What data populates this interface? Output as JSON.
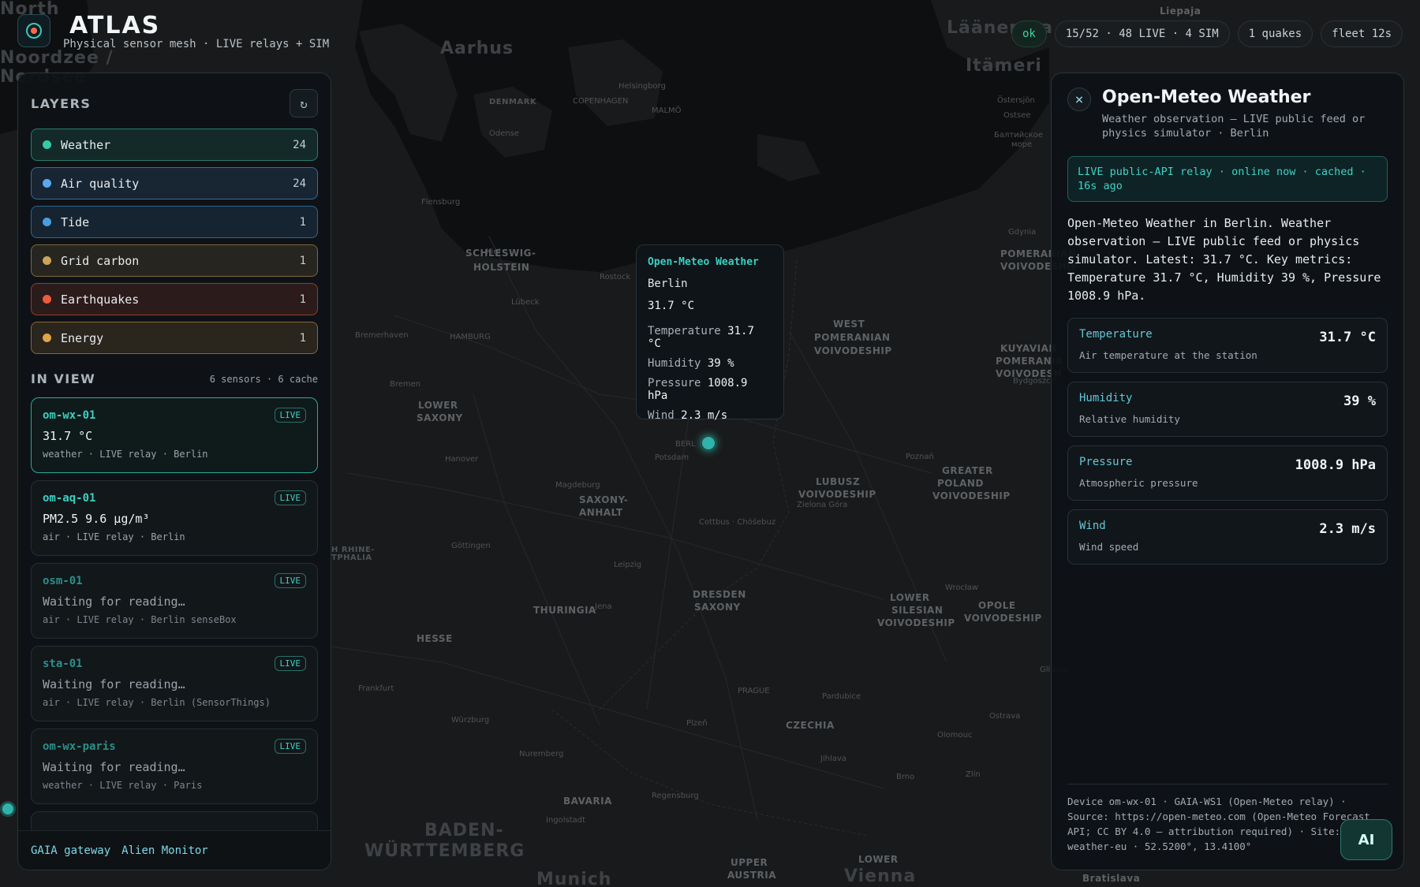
{
  "app": {
    "title": "ATLAS",
    "subtitle": "Physical sensor mesh · LIVE relays + SIM"
  },
  "status": {
    "ok": "ok",
    "counts": "15/52 · 48 LIVE · 4 SIM",
    "quakes": "1 quakes",
    "fleet": "fleet 12s"
  },
  "layers_panel": {
    "title": "LAYERS",
    "refresh_icon": "↻",
    "layers": [
      {
        "name": "Weather",
        "count": "24",
        "color": "#36c9a8"
      },
      {
        "name": "Air quality",
        "count": "24",
        "color": "#5aa8f0"
      },
      {
        "name": "Tide",
        "count": "1",
        "color": "#4a9ee0"
      },
      {
        "name": "Grid carbon",
        "count": "1",
        "color": "#c9a45a"
      },
      {
        "name": "Earthquakes",
        "count": "1",
        "color": "#ee5a3e"
      },
      {
        "name": "Energy",
        "count": "1",
        "color": "#e0a34a"
      }
    ]
  },
  "in_view": {
    "title": "IN VIEW",
    "meta": "6 sensors · 6 cache",
    "cards": [
      {
        "id": "om-wx-01",
        "badge": "LIVE",
        "value": "31.7 °C",
        "meta": "weather · LIVE relay · Berlin"
      },
      {
        "id": "om-aq-01",
        "badge": "LIVE",
        "value": "PM2.5 9.6 µg/m³",
        "meta": "air · LIVE relay · Berlin"
      },
      {
        "id": "osm-01",
        "badge": "LIVE",
        "value": "Waiting for reading…",
        "meta": "air · LIVE relay · Berlin senseBox"
      },
      {
        "id": "sta-01",
        "badge": "LIVE",
        "value": "Waiting for reading…",
        "meta": "air · LIVE relay · Berlin (SensorThings)"
      },
      {
        "id": "om-wx-paris",
        "badge": "LIVE",
        "value": "Waiting for reading…",
        "meta": "weather · LIVE relay · Paris"
      }
    ]
  },
  "left_footer": {
    "gateway": "GAIA gateway",
    "monitor": "Alien Monitor"
  },
  "popup": {
    "title": "Open-Meteo Weather",
    "city": "Berlin",
    "value": "31.7 °C",
    "rows": [
      {
        "label": "Temperature",
        "value": "31.7 °C"
      },
      {
        "label": "Humidity",
        "value": "39 %"
      },
      {
        "label": "Pressure",
        "value": "1008.9 hPa"
      },
      {
        "label": "Wind",
        "value": "2.3 m/s"
      }
    ]
  },
  "detail": {
    "close_icon": "×",
    "title": "Open-Meteo Weather",
    "subtitle": "Weather observation — LIVE public feed or physics simulator · Berlin",
    "live_status": "LIVE public-API relay · online now · cached · 16s ago",
    "description": "Open-Meteo Weather in Berlin. Weather observation — LIVE public feed or physics simulator. Latest: 31.7 °C. Key metrics: Temperature 31.7 °C, Humidity 39 %, Pressure 1008.9 hPa.",
    "metrics": [
      {
        "name": "Temperature",
        "desc": "Air temperature at the station",
        "value": "31.7 °C"
      },
      {
        "name": "Humidity",
        "desc": "Relative humidity",
        "value": "39 %"
      },
      {
        "name": "Pressure",
        "desc": "Atmospheric pressure",
        "value": "1008.9 hPa"
      },
      {
        "name": "Wind",
        "desc": "Wind speed",
        "value": "2.3 m/s"
      }
    ],
    "footer": "Device om-wx-01 · GAIA-WS1 (Open-Meteo relay) · Source: https://open-meteo.com (Open-Meteo Forecast API; CC BY 4.0 — attribution required) · Site: live-weather-eu · 52.5200°, 13.4100°",
    "ai_label": "AI"
  },
  "map_labels": {
    "regions": [
      "DENMARK",
      "SCHLESWIG-HOLSTEIN",
      "WEST POMERANIAN VOIVODESHIP",
      "POMERANIAN VOIVODESHIP",
      "KUYAVIAN POMERANIAN VOIVODESHIP",
      "LOWER SAXONY",
      "SAXONY-ANHALT",
      "LUBUSZ VOIVODESHIP",
      "GREATER POLAND VOIVODESHIP",
      "THURINGIA",
      "DRESDEN SAXONY",
      "LOWER SILESIAN VOIVODESHIP",
      "OPOLE VOIVODESHIP",
      "HESSE",
      "CZECHIA",
      "BAVARIA",
      "BADEN-WÜRTTEMBERG",
      "UPPER AUSTRIA",
      "LOWER AUSTRIA",
      "NORTH RHINE-WESTPHALIA"
    ],
    "cities": [
      "COPENHAGEN",
      "MALMÖ",
      "Aarhus",
      "Odense",
      "Helsingborg",
      "Flensburg",
      "Kiel",
      "Lübeck",
      "Rostock",
      "HAMBURG",
      "Bremerhaven",
      "Bremen",
      "Hanover",
      "Magdeburg",
      "BERLIN",
      "Potsdam",
      "Cottbus · Chóśebuz",
      "Zielona Góra",
      "Poznań",
      "Bydgoszcz",
      "Gdynia",
      "Göttingen",
      "Leipzig",
      "Jena",
      "Wrocław",
      "PRAGUE",
      "Pardubice",
      "Plzeň",
      "Brno",
      "Jihlava",
      "Zlín",
      "Olomouc",
      "Ostrava",
      "Gliwice",
      "Nuremberg",
      "Würzburg",
      "Regensburg",
      "Ingolstadt",
      "Munich",
      "Vienna",
      "Bratislava",
      "Frankfurt",
      "Liepaja",
      "Läänemaa",
      "Itämeri",
      "Östersjön",
      "Balti meri",
      "Балтийское море"
    ],
    "sea": [
      "North",
      "Noordzee /",
      "Nordsee"
    ]
  }
}
